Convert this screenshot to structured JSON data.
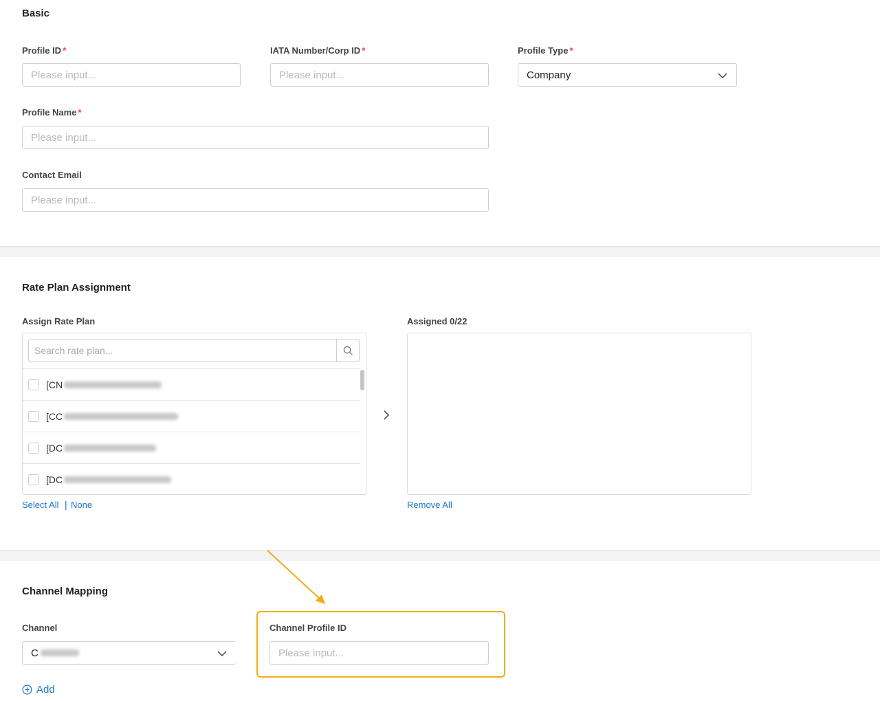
{
  "basic": {
    "title": "Basic",
    "profile_id": {
      "label": "Profile ID",
      "required": "*",
      "placeholder": "Please input..."
    },
    "iata": {
      "label": "IATA Number/Corp ID",
      "required": "*",
      "placeholder": "Please input..."
    },
    "profile_type": {
      "label": "Profile Type",
      "required": "*",
      "value": "Company"
    },
    "profile_name": {
      "label": "Profile Name",
      "required": "*",
      "placeholder": "Please input..."
    },
    "contact_email": {
      "label": "Contact Email",
      "placeholder": "Please input..."
    }
  },
  "rate_plan": {
    "title": "Rate Plan Assignment",
    "assign_label": "Assign Rate Plan",
    "search_placeholder": "Search rate plan...",
    "items": [
      {
        "prefix": "[CN"
      },
      {
        "prefix": "[CC"
      },
      {
        "prefix": "[DC"
      },
      {
        "prefix": "[DC"
      }
    ],
    "select_all": "Select All",
    "separator": "|",
    "none": "None",
    "assigned_label": "Assigned 0/22",
    "remove_all": "Remove All"
  },
  "channel_mapping": {
    "title": "Channel Mapping",
    "channel_label": "Channel",
    "channel_value": "C",
    "profile_id_label": "Channel Profile ID",
    "profile_id_placeholder": "Please input...",
    "add_label": "Add"
  },
  "colors": {
    "accent_link": "#1a73c8",
    "required": "#e94040",
    "highlight": "#f5ab13"
  }
}
